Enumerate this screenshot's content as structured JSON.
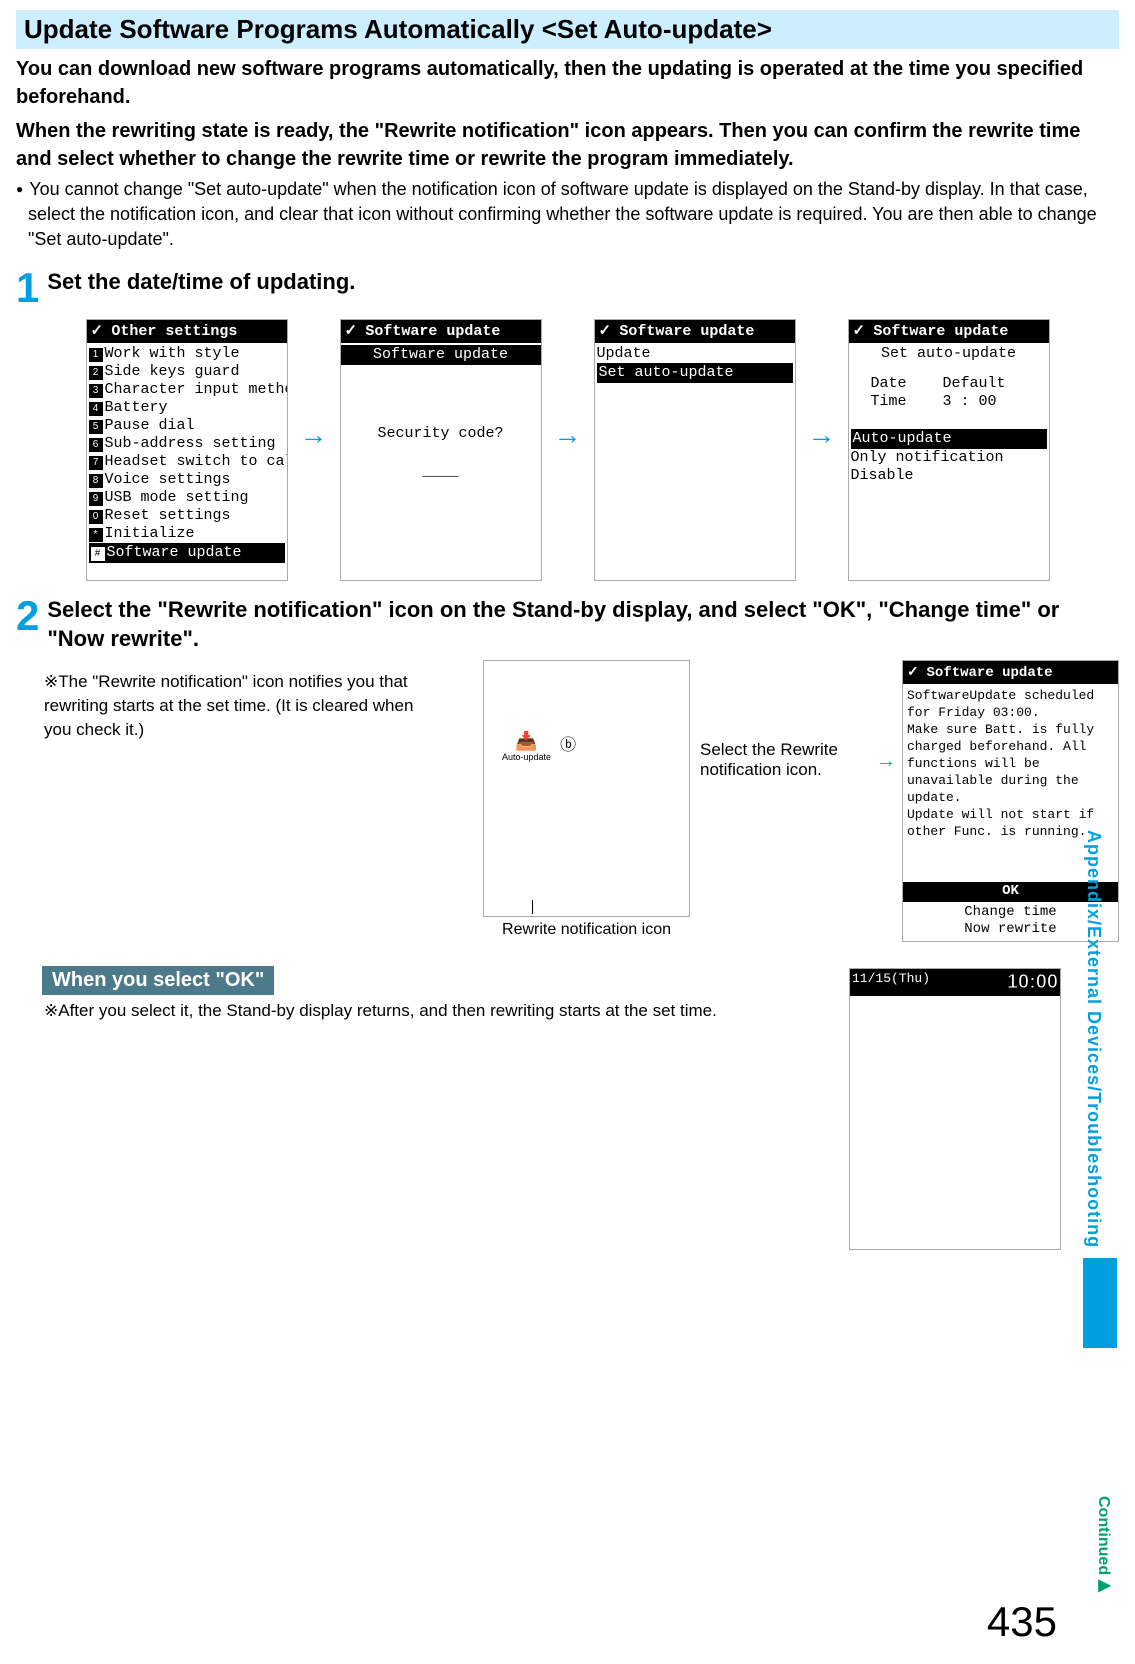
{
  "header": "Update Software Programs Automatically <Set Auto-update>",
  "lead1": "You can download new software programs automatically, then the updating is operated at the time you specified beforehand.",
  "lead2": "When the rewriting state is ready, the \"Rewrite notification\" icon appears. Then you can confirm the rewrite time and select whether to change the rewrite time or rewrite the program immediately.",
  "bullet1": "You cannot change \"Set auto-update\" when the notification icon of software update is displayed on the Stand-by display. In that case, select the notification icon, and clear that icon without confirming whether the software update is required. You are then able to change \"Set auto-update\".",
  "step1": {
    "num": "1",
    "text": "Set the date/time of updating."
  },
  "step2": {
    "num": "2",
    "text": "Select the \"Rewrite notification\" icon on the Stand-by display, and select \"OK\", \"Change time\" or \"Now rewrite\"."
  },
  "screens1": {
    "s1": {
      "title": "Other settings",
      "lines": [
        "Work with style",
        "Side keys guard",
        "Character input method",
        "Battery",
        "Pause dial",
        "Sub-address setting",
        "Headset switch to call",
        "Voice settings",
        "USB mode setting",
        "Reset settings",
        "Initialize"
      ],
      "sel": "Software update"
    },
    "s2": {
      "title": "Software update",
      "sub": "Software update",
      "body": "Security code?",
      "blank": "____"
    },
    "s3": {
      "title": "Software update",
      "l1": "Update",
      "sel": "Set auto-update"
    },
    "s4": {
      "title": "Software update",
      "sub": "Set auto-update",
      "rows": [
        "Date    Default",
        "Time    3 : 00"
      ],
      "sel": "Auto-update",
      "after": [
        "Only notification",
        "Disable"
      ]
    }
  },
  "note2": "※The \"Rewrite notification\" icon notifies you that rewriting starts at the set time. (It is cleared when you check it.)",
  "rewrite_caption": "Rewrite notification icon",
  "select_note": "Select the Rewrite notification icon.",
  "auto_label": "Auto-update",
  "update_screen": {
    "title": "Software update",
    "body": "SoftwareUpdate scheduled for Friday 03:00.\nMake sure Batt. is fully charged beforehand. All functions will be unavailable during the update.\nUpdate will not start if other Func. is running.",
    "ok": "OK",
    "opt1": "Change time",
    "opt2": "Now rewrite"
  },
  "sub_header": "When you select \"OK\"",
  "after_ok": "※After you select it, the Stand-by display returns, and then rewriting starts at the set time.",
  "standby": {
    "date": "11/15(Thu)",
    "time": "10:00"
  },
  "side": "Appendix/External Devices/Troubleshooting",
  "continued": "Continued",
  "page": "435"
}
